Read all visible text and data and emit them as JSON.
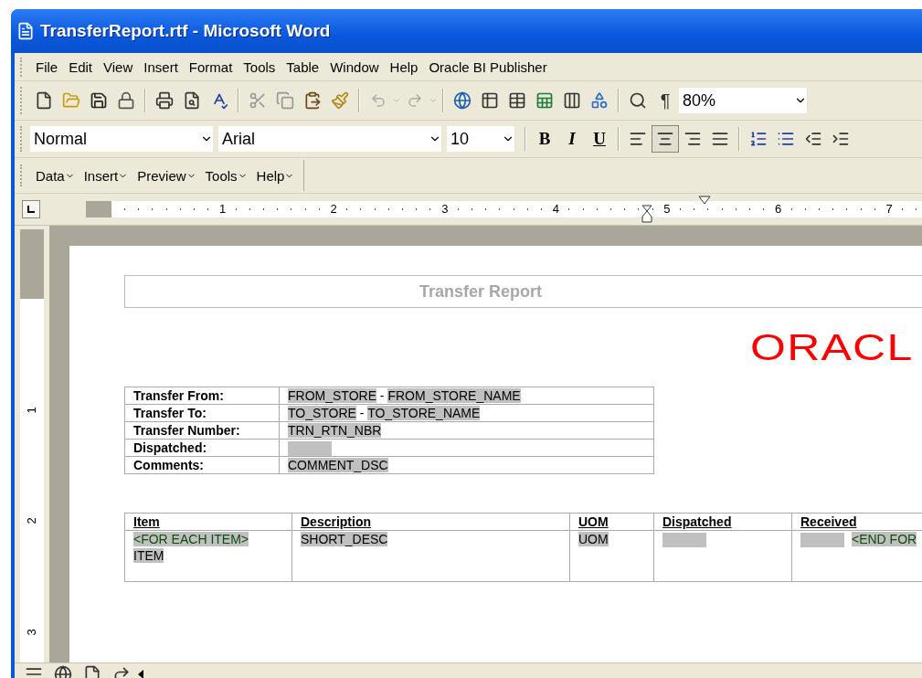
{
  "window": {
    "title": "TransferReport.rtf - Microsoft Word"
  },
  "menu_bar": [
    "File",
    "Edit",
    "View",
    "Insert",
    "Format",
    "Tools",
    "Table",
    "Window",
    "Help",
    "Oracle BI Publisher"
  ],
  "standard_toolbar": {
    "pilcrow": "¶",
    "zoom": "80%"
  },
  "formatting_toolbar": {
    "style": "Normal",
    "font": "Arial",
    "size": "10",
    "text_buttons": [
      {
        "label": "B",
        "kind": "bold"
      },
      {
        "label": "I",
        "kind": "italic"
      },
      {
        "label": "U",
        "kind": "underline"
      }
    ],
    "alignment": [
      {
        "kind": "left",
        "selected": false
      },
      {
        "kind": "center",
        "selected": true
      },
      {
        "kind": "right",
        "selected": false
      },
      {
        "kind": "justify",
        "selected": false
      }
    ]
  },
  "bi_publisher_toolbar": [
    "Data",
    "Insert",
    "Preview",
    "Tools",
    "Help"
  ],
  "horizontal_ruler": [
    "1",
    "2",
    "3",
    "4",
    "5",
    "6",
    "7"
  ],
  "vertical_ruler": [
    "1",
    "2",
    "3"
  ],
  "document": {
    "title": "Transfer Report",
    "logo": "ORACL",
    "header_table": [
      {
        "label": "Transfer From:",
        "value": [
          {
            "kind": "field",
            "text": "FROM_STORE"
          },
          {
            "kind": "plain",
            "text": " - "
          },
          {
            "kind": "field",
            "text": "FROM_STORE_NAME"
          }
        ]
      },
      {
        "label": "Transfer To:",
        "value": [
          {
            "kind": "field",
            "text": "TO_STORE"
          },
          {
            "kind": "plain",
            "text": " - "
          },
          {
            "kind": "field",
            "text": "TO_STORE_NAME"
          }
        ]
      },
      {
        "label": "Transfer Number:",
        "value": [
          {
            "kind": "field",
            "text": "TRN_RTN_NBR"
          }
        ]
      },
      {
        "label": "Dispatched:",
        "value": [
          {
            "kind": "blank_field"
          }
        ]
      },
      {
        "label": "Comments:",
        "value": [
          {
            "kind": "field",
            "text": "COMMENT_DSC"
          }
        ]
      }
    ],
    "items_table": {
      "columns": [
        "Item",
        "Description",
        "UOM",
        "Dispatched",
        "Received"
      ],
      "row": [
        [
          {
            "kind": "tag",
            "text": "<FOR EACH ITEM>"
          },
          {
            "kind": "break"
          },
          {
            "kind": "field",
            "text": "ITEM"
          }
        ],
        [
          {
            "kind": "field",
            "text": "SHORT_DESC"
          }
        ],
        [
          {
            "kind": "field",
            "text": "UOM"
          }
        ],
        [
          {
            "kind": "blank_field"
          }
        ],
        [
          {
            "kind": "blank_field"
          },
          {
            "kind": "tag",
            "text": "<END FOR"
          }
        ]
      ]
    }
  }
}
